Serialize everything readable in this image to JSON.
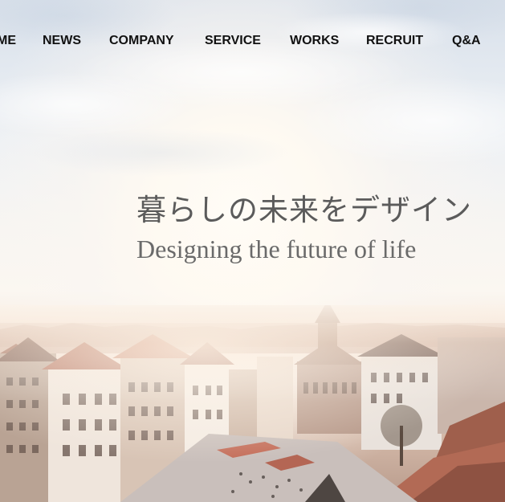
{
  "nav": {
    "items": [
      {
        "label": "ME"
      },
      {
        "label": "NEWS"
      },
      {
        "label": "COMPANY"
      },
      {
        "label": "SERVICE"
      },
      {
        "label": "WORKS"
      },
      {
        "label": "RECRUIT"
      },
      {
        "label": "Q&A"
      }
    ]
  },
  "hero": {
    "title_jp": "暮らしの未来をデザイン",
    "title_en": "Designing the future of life"
  },
  "colors": {
    "nav_text": "#111111",
    "title_text": "#5b5b5b",
    "sky_top": "#d8e0ea",
    "sun_glow": "#fbf7f1",
    "roof_terracotta": "#b06a55"
  }
}
